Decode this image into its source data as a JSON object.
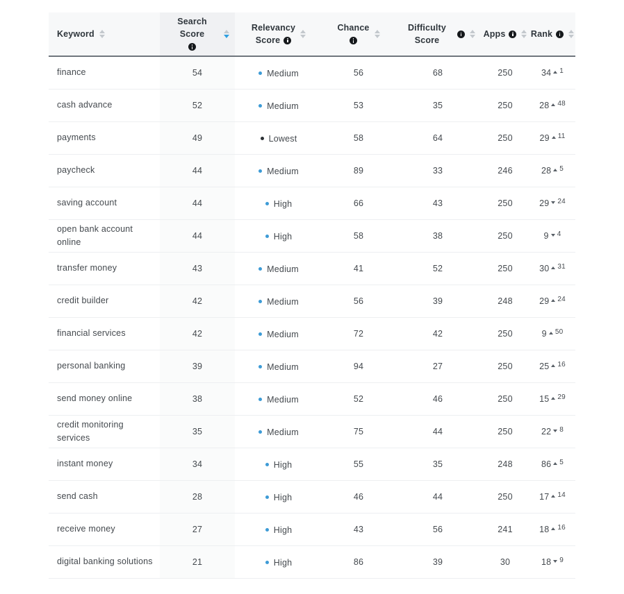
{
  "table": {
    "columns": [
      {
        "key": "keyword",
        "label_lines": [
          "Keyword"
        ],
        "has_info": false,
        "sort": "none",
        "align": "left"
      },
      {
        "key": "search",
        "label_lines": [
          "Search Score"
        ],
        "has_info": true,
        "sort": "descending",
        "align": "center"
      },
      {
        "key": "relevancy",
        "label_lines": [
          "Relevancy",
          "Score"
        ],
        "has_info": true,
        "sort": "none",
        "align": "center"
      },
      {
        "key": "chance",
        "label_lines": [
          "Chance"
        ],
        "has_info": true,
        "sort": "none",
        "align": "center"
      },
      {
        "key": "difficulty",
        "label_lines": [
          "Difficulty Score"
        ],
        "has_info": true,
        "sort": "none",
        "align": "center"
      },
      {
        "key": "apps",
        "label_lines": [
          "Apps"
        ],
        "has_info": true,
        "sort": "none",
        "align": "center"
      },
      {
        "key": "rank",
        "label_lines": [
          "Rank"
        ],
        "has_info": true,
        "sort": "none",
        "align": "center"
      }
    ],
    "rows": [
      {
        "keyword": "finance",
        "search_score": "54",
        "relevancy": "Medium",
        "relevancy_level": "medium",
        "chance": "56",
        "difficulty": "68",
        "apps": "250",
        "rank": "34",
        "rank_dir": "up",
        "rank_delta": "1"
      },
      {
        "keyword": "cash advance",
        "search_score": "52",
        "relevancy": "Medium",
        "relevancy_level": "medium",
        "chance": "53",
        "difficulty": "35",
        "apps": "250",
        "rank": "28",
        "rank_dir": "up",
        "rank_delta": "48"
      },
      {
        "keyword": "payments",
        "search_score": "49",
        "relevancy": "Lowest",
        "relevancy_level": "lowest",
        "chance": "58",
        "difficulty": "64",
        "apps": "250",
        "rank": "29",
        "rank_dir": "up",
        "rank_delta": "11"
      },
      {
        "keyword": "paycheck",
        "search_score": "44",
        "relevancy": "Medium",
        "relevancy_level": "medium",
        "chance": "89",
        "difficulty": "33",
        "apps": "246",
        "rank": "28",
        "rank_dir": "up",
        "rank_delta": "5"
      },
      {
        "keyword": "saving account",
        "search_score": "44",
        "relevancy": "High",
        "relevancy_level": "high",
        "chance": "66",
        "difficulty": "43",
        "apps": "250",
        "rank": "29",
        "rank_dir": "down",
        "rank_delta": "24"
      },
      {
        "keyword": "open bank account online",
        "search_score": "44",
        "relevancy": "High",
        "relevancy_level": "high",
        "chance": "58",
        "difficulty": "38",
        "apps": "250",
        "rank": "9",
        "rank_dir": "down",
        "rank_delta": "4"
      },
      {
        "keyword": "transfer money",
        "search_score": "43",
        "relevancy": "Medium",
        "relevancy_level": "medium",
        "chance": "41",
        "difficulty": "52",
        "apps": "250",
        "rank": "30",
        "rank_dir": "up",
        "rank_delta": "31"
      },
      {
        "keyword": "credit builder",
        "search_score": "42",
        "relevancy": "Medium",
        "relevancy_level": "medium",
        "chance": "56",
        "difficulty": "39",
        "apps": "248",
        "rank": "29",
        "rank_dir": "up",
        "rank_delta": "24"
      },
      {
        "keyword": "financial services",
        "search_score": "42",
        "relevancy": "Medium",
        "relevancy_level": "medium",
        "chance": "72",
        "difficulty": "42",
        "apps": "250",
        "rank": "9",
        "rank_dir": "up",
        "rank_delta": "50"
      },
      {
        "keyword": "personal banking",
        "search_score": "39",
        "relevancy": "Medium",
        "relevancy_level": "medium",
        "chance": "94",
        "difficulty": "27",
        "apps": "250",
        "rank": "25",
        "rank_dir": "up",
        "rank_delta": "16"
      },
      {
        "keyword": "send money online",
        "search_score": "38",
        "relevancy": "Medium",
        "relevancy_level": "medium",
        "chance": "52",
        "difficulty": "46",
        "apps": "250",
        "rank": "15",
        "rank_dir": "up",
        "rank_delta": "29"
      },
      {
        "keyword": "credit monitoring services",
        "search_score": "35",
        "relevancy": "Medium",
        "relevancy_level": "medium",
        "chance": "75",
        "difficulty": "44",
        "apps": "250",
        "rank": "22",
        "rank_dir": "down",
        "rank_delta": "8"
      },
      {
        "keyword": "instant money",
        "search_score": "34",
        "relevancy": "High",
        "relevancy_level": "high",
        "chance": "55",
        "difficulty": "35",
        "apps": "248",
        "rank": "86",
        "rank_dir": "up",
        "rank_delta": "5"
      },
      {
        "keyword": "send cash",
        "search_score": "28",
        "relevancy": "High",
        "relevancy_level": "high",
        "chance": "46",
        "difficulty": "44",
        "apps": "250",
        "rank": "17",
        "rank_dir": "up",
        "rank_delta": "14"
      },
      {
        "keyword": "receive money",
        "search_score": "27",
        "relevancy": "High",
        "relevancy_level": "high",
        "chance": "43",
        "difficulty": "56",
        "apps": "241",
        "rank": "18",
        "rank_dir": "up",
        "rank_delta": "16"
      },
      {
        "keyword": "digital banking solutions",
        "search_score": "21",
        "relevancy": "High",
        "relevancy_level": "high",
        "chance": "86",
        "difficulty": "39",
        "apps": "30",
        "rank": "18",
        "rank_dir": "down",
        "rank_delta": "9"
      }
    ]
  },
  "colors": {
    "accent_blue": "#2f9fe0",
    "dot_blue": "#3d9bd6",
    "dot_dark": "#2b3034",
    "header_bg": "#f7f8f9",
    "header_active_bg": "#f0f1f3",
    "text": "#44494e",
    "row_divider": "#edeff1"
  }
}
